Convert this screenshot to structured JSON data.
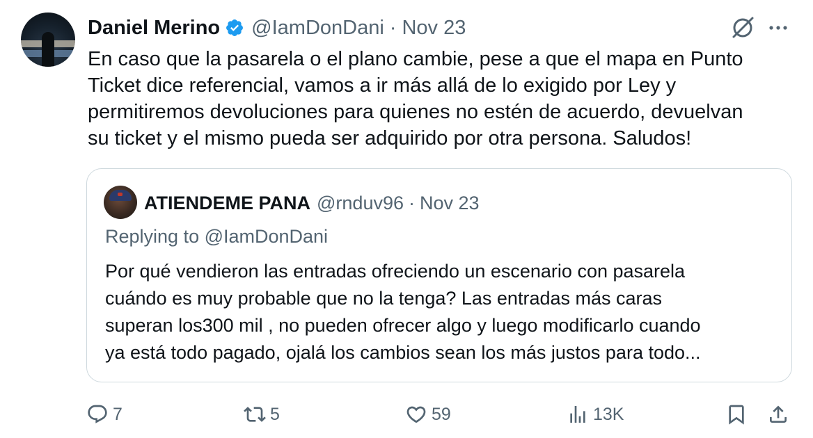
{
  "tweet": {
    "author_name": "Daniel Merino",
    "handle": "@IamDonDani",
    "separator": "·",
    "date": "Nov 23",
    "text_lines": [
      "En caso que la pasarela o el plano cambie, pese a que el mapa en Punto",
      "Ticket dice referencial, vamos a ir más allá de lo exigido por Ley y",
      "permitiremos devoluciones para quienes no estén de acuerdo, devuelvan",
      "su ticket y el mismo pueda ser adquirido por otra persona. Saludos!"
    ]
  },
  "quote": {
    "author_name": "ATIENDEME PANA",
    "handle": "@rnduv96",
    "separator": "·",
    "date": "Nov 23",
    "replying_to": "Replying to @IamDonDani",
    "text_lines": [
      "Por qué vendieron las entradas ofreciendo un escenario con pasarela",
      "cuándo es muy probable que no la tenga? Las entradas más caras",
      "superan los300 mil , no pueden ofrecer algo y luego modificarlo cuando",
      "ya está todo pagado, ojalá los cambios sean los más justos para todo..."
    ]
  },
  "actions": {
    "replies": "7",
    "reposts": "5",
    "likes": "59",
    "views": "13K"
  },
  "icons": {
    "verified": "verified-badge-icon",
    "grok": "grok-icon",
    "more": "more-icon",
    "reply": "reply-icon",
    "repost": "repost-icon",
    "like": "heart-icon",
    "views": "views-icon",
    "bookmark": "bookmark-icon",
    "share": "share-icon"
  },
  "colors": {
    "text": "#0f1419",
    "secondary": "#536471",
    "verified": "#1d9bf0",
    "border": "#cfd9de"
  }
}
